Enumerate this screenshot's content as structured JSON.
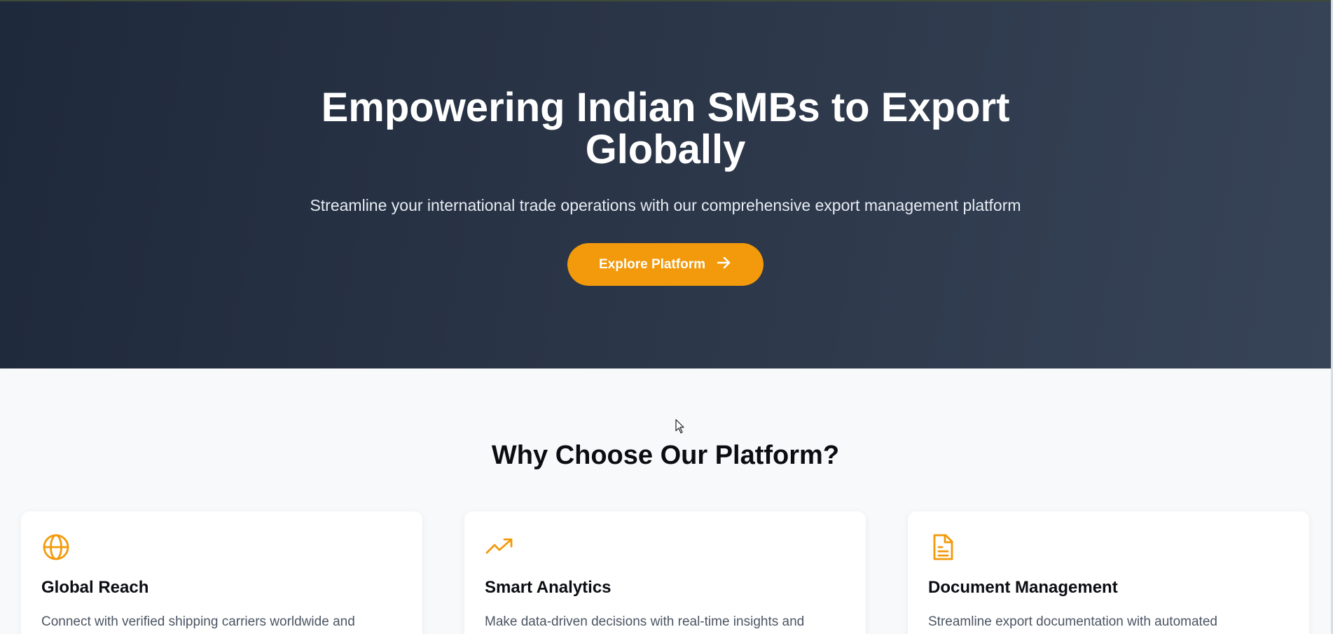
{
  "hero": {
    "title": "Empowering Indian SMBs to Export Globally",
    "subtitle": "Streamline your international trade operations with our comprehensive export management platform",
    "cta_label": "Explore Platform",
    "cta_icon": "arrow-right-icon"
  },
  "features": {
    "title": "Why Choose Our Platform?",
    "cards": [
      {
        "icon": "globe-icon",
        "title": "Global Reach",
        "description": "Connect with verified shipping carriers worldwide and"
      },
      {
        "icon": "trending-up-icon",
        "title": "Smart Analytics",
        "description": "Make data-driven decisions with real-time insights and"
      },
      {
        "icon": "document-icon",
        "title": "Document Management",
        "description": "Streamline export documentation with automated"
      }
    ]
  },
  "colors": {
    "hero_background": "#1e293b",
    "accent": "#f29a0b",
    "page_background": "#f8f9fa"
  }
}
